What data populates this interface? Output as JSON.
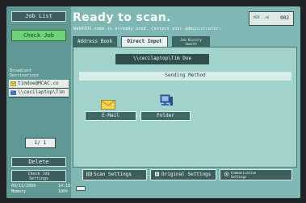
{
  "left_panel": {
    "job_list": "Job List",
    "check_job": "Check Job",
    "broadcast_label_line1": "Broadcast",
    "broadcast_label_line2": "Destinations",
    "destinations": [
      {
        "text": "timdoe@MCAC.co",
        "icon": "email-icon"
      },
      {
        "text": "\\\\cecilaptop\\Tim",
        "icon": "folder-icon"
      }
    ],
    "page_indicator": "1/ 1",
    "delete": "Delete",
    "check_settings_line1": "Check Job",
    "check_settings_line2": "Settings"
  },
  "header": {
    "title": "Ready to scan.",
    "subtitle": "WebDIOS name is already used. Contact your administrator.",
    "memory_label": "MEM...ed",
    "memory_value": "002"
  },
  "tabs": [
    {
      "label": "Address Book"
    },
    {
      "label": "Direct Input"
    },
    {
      "label_line1": "Job History",
      "label_line2": "Search"
    }
  ],
  "main": {
    "destination_display": "\\\\cecilaptop\\Tim Doe",
    "sending_method_header": "Sending Method",
    "email_button": "E-Mail",
    "folder_button": "Folder"
  },
  "bottom_buttons": {
    "scan_settings": "Scan Settings",
    "original_settings": "Original Settings",
    "communication_settings_line1": "Communication",
    "communication_settings_line2": "Settings"
  },
  "footer": {
    "date": "09/11/2009",
    "time": "14:18",
    "memory_label": "Memory",
    "memory_percent": "100%"
  },
  "colors": {
    "screen_bg": "#7fb8b3",
    "panel_bg": "#5f9793",
    "button_bg": "#3d5f5c",
    "active_button": "#6ed37a"
  }
}
